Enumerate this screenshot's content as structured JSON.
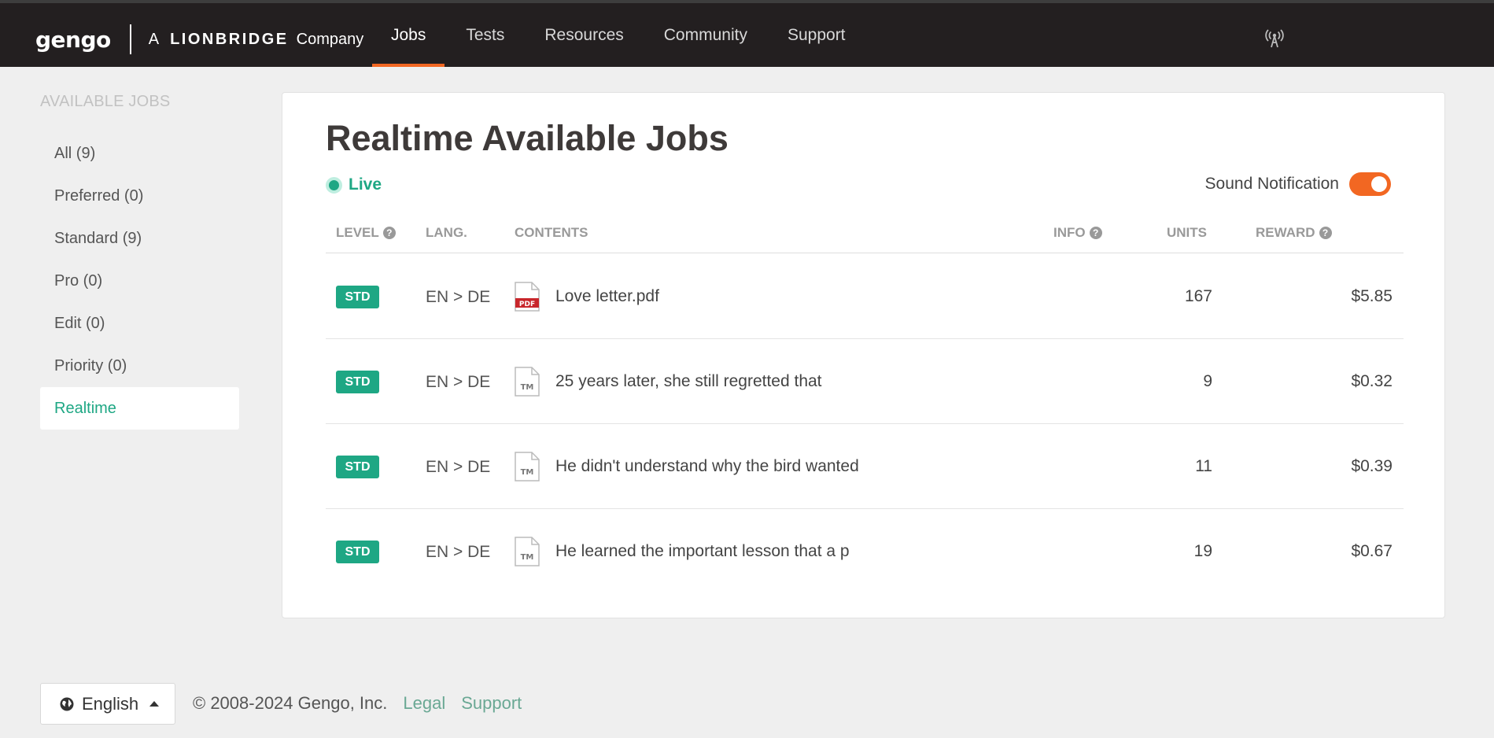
{
  "brand": {
    "logo": "gengo",
    "prefix": "A",
    "lionbridge": "LIONBRIDGE",
    "company": "Company"
  },
  "nav": [
    {
      "label": "Jobs",
      "active": true
    },
    {
      "label": "Tests"
    },
    {
      "label": "Resources"
    },
    {
      "label": "Community"
    },
    {
      "label": "Support"
    }
  ],
  "sidebar": {
    "heading": "AVAILABLE JOBS",
    "items": [
      {
        "label": "All (9)"
      },
      {
        "label": "Preferred (0)"
      },
      {
        "label": "Standard (9)"
      },
      {
        "label": "Pro (0)"
      },
      {
        "label": "Edit (0)"
      },
      {
        "label": "Priority (0)"
      },
      {
        "label": "Realtime",
        "active": true
      }
    ]
  },
  "main": {
    "title": "Realtime Available Jobs",
    "live_label": "Live",
    "sound_label": "Sound Notification",
    "sound_on": true,
    "columns": {
      "level": "LEVEL",
      "lang": "LANG.",
      "contents": "CONTENTS",
      "info": "INFO",
      "units": "UNITS",
      "reward": "REWARD"
    },
    "jobs": [
      {
        "level": "STD",
        "lang": "EN > DE",
        "icon": "pdf-file-icon",
        "icon_label": "PDF",
        "contents": "Love letter.pdf",
        "units": "167",
        "reward": "$5.85"
      },
      {
        "level": "STD",
        "lang": "EN > DE",
        "icon": "text-file-icon",
        "icon_label": "TM",
        "contents": "25 years later, she still regretted that",
        "units": "9",
        "reward": "$0.32"
      },
      {
        "level": "STD",
        "lang": "EN > DE",
        "icon": "text-file-icon",
        "icon_label": "TM",
        "contents": "He didn't understand why the bird wanted",
        "units": "11",
        "reward": "$0.39"
      },
      {
        "level": "STD",
        "lang": "EN > DE",
        "icon": "text-file-icon",
        "icon_label": "TM",
        "contents": "He learned the important lesson that a p",
        "units": "19",
        "reward": "$0.67"
      }
    ]
  },
  "footer": {
    "language": "English",
    "copyright": "© 2008-2024 Gengo, Inc.",
    "legal": "Legal",
    "support": "Support"
  },
  "colors": {
    "accent_green": "#1ea784",
    "accent_orange": "#f26722",
    "topbar": "#231f20"
  }
}
